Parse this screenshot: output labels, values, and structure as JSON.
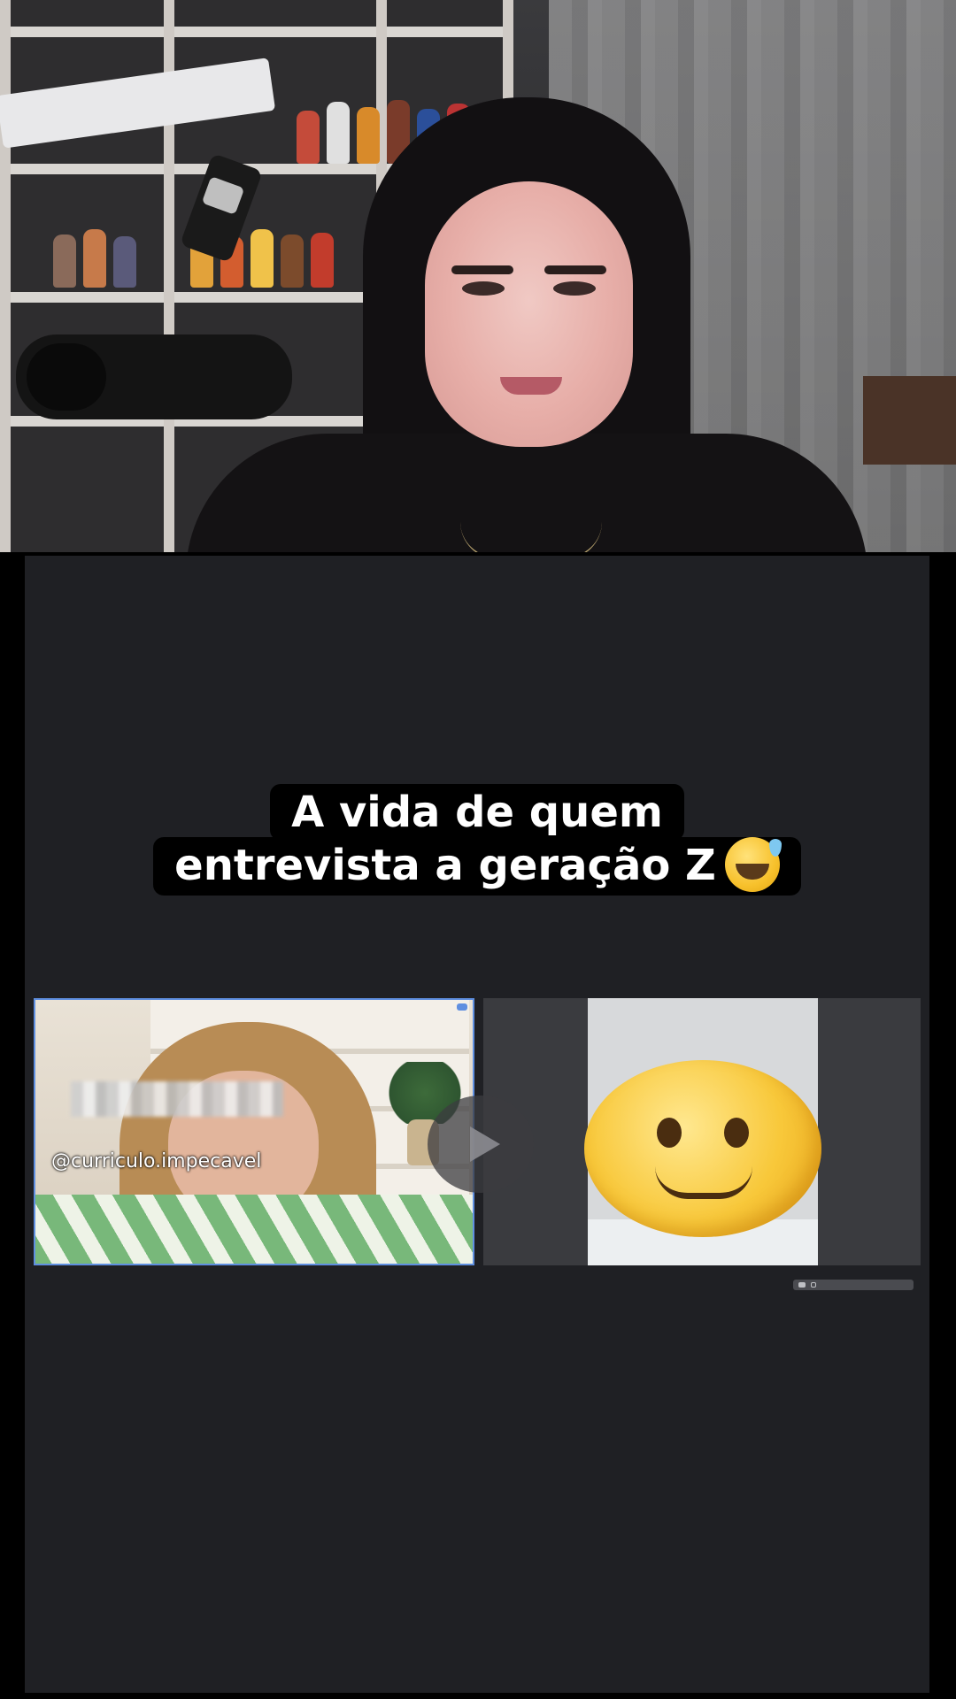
{
  "caption": {
    "line1": "A vida de quem",
    "line2": "entrevista a geração Z"
  },
  "caption_emoji": "grinning-sweat-emoji",
  "left_call": {
    "watermark": "@curriculo.impecavel"
  },
  "right_call": {
    "face_cover": "slightly-smiling-face-emoji"
  },
  "colors": {
    "panel_background": "#1f2024",
    "call_border": "#5f8fe0",
    "caption_box": "#000000"
  }
}
